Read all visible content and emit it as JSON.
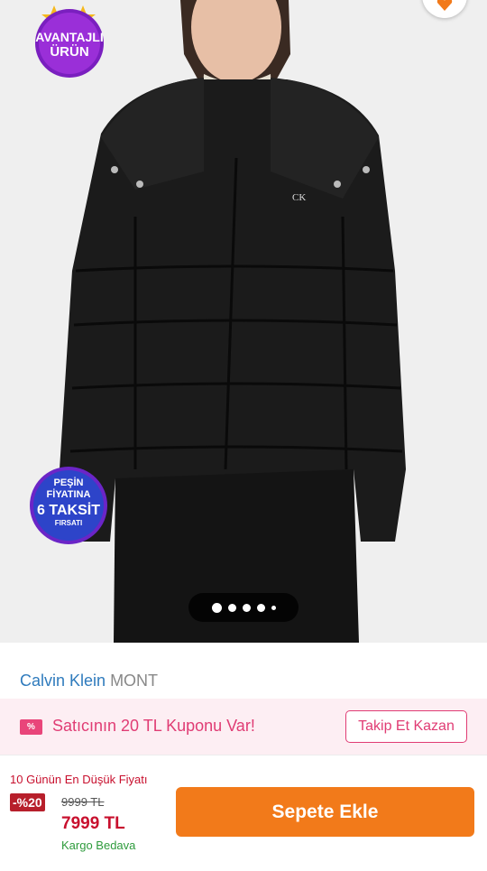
{
  "gallery": {
    "badges": {
      "avantajli_line1": "AVANTAJLI",
      "avantajli_line2": "ÜRÜN",
      "pesin_line1": "PEŞİN",
      "pesin_line2": "FİYATINA",
      "pesin_line3": "6 TAKSİT",
      "pesin_line4": "FIRSATI"
    },
    "image_count": 5,
    "active_index": 0,
    "jacket_logo": "CK"
  },
  "product": {
    "brand": "Calvin Klein",
    "type": "MONT"
  },
  "coupon": {
    "icon_text": "%",
    "text": "Satıcının 20 TL Kuponu Var!",
    "follow_label": "Takip Et Kazan"
  },
  "price": {
    "lowest_label": "10 Günün En Düşük Fiyatı",
    "discount": "-%20",
    "old": "9999 TL",
    "new": "7999 TL",
    "cargo": "Kargo Bedava"
  },
  "cart": {
    "label": "Sepete Ekle"
  },
  "colors": {
    "brand_blue": "#2f7bbd",
    "coupon_pink": "#e03c74",
    "price_red": "#c8102e",
    "cart_orange": "#f27a1a",
    "cargo_green": "#2e9b3c"
  }
}
